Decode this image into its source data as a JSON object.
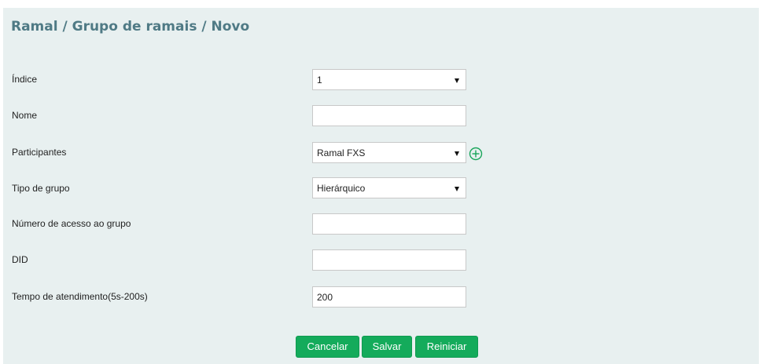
{
  "page": {
    "title": "Ramal / Grupo de ramais / Novo"
  },
  "form": {
    "indice": {
      "label": "Índice",
      "value": "1"
    },
    "nome": {
      "label": "Nome",
      "value": "",
      "placeholder": ""
    },
    "participantes": {
      "label": "Participantes",
      "value": "Ramal FXS",
      "add_icon": "plus-circle-icon"
    },
    "tipo_grupo": {
      "label": "Tipo de grupo",
      "value": "Hierárquico"
    },
    "numero_acesso": {
      "label": "Número de acesso ao grupo",
      "value": "",
      "placeholder": ""
    },
    "did": {
      "label": "DID",
      "value": "",
      "placeholder": ""
    },
    "tempo_atendimento": {
      "label": "Tempo de atendimento(5s-200s)",
      "value": "200"
    }
  },
  "actions": {
    "cancel_label": "Cancelar",
    "save_label": "Salvar",
    "reset_label": "Reiniciar"
  },
  "colors": {
    "panel_bg": "#e8f0f0",
    "title": "#4f7a85",
    "button": "#14ab5b",
    "add_icon": "#19a55a"
  }
}
